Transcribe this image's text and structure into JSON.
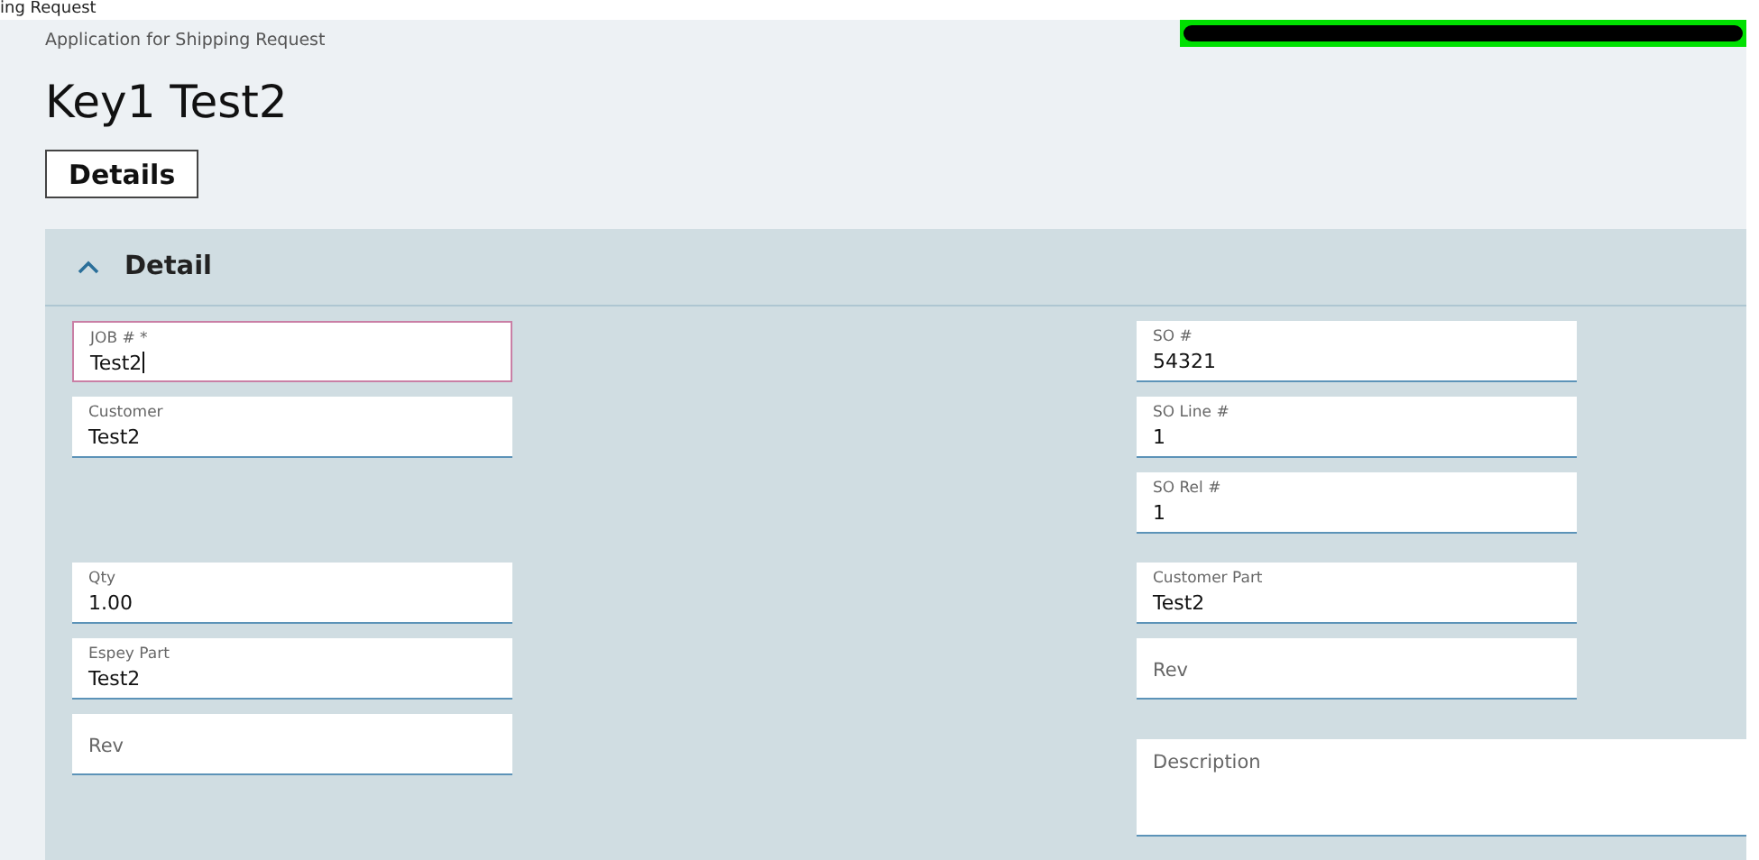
{
  "window": {
    "title": "ing Request"
  },
  "breadcrumb": "Application for Shipping Request",
  "page_title": "Key1 Test2",
  "tabs": [
    {
      "label": "Details",
      "selected": true
    }
  ],
  "section": {
    "title": "Detail",
    "expanded": true,
    "left_fields": [
      {
        "kind": "text",
        "label": "JOB # *",
        "value": "Test2",
        "focused": true
      },
      {
        "kind": "text",
        "label": "Customer",
        "value": "Test2",
        "focused": false
      },
      {
        "kind": "text",
        "label": "Qty",
        "value": "1.00",
        "focused": false
      },
      {
        "kind": "text",
        "label": "Espey Part",
        "value": "Test2",
        "focused": false
      },
      {
        "kind": "text",
        "label": "Rev",
        "focused": false
      }
    ],
    "right_fields": [
      {
        "kind": "text",
        "label": "SO #",
        "value": "54321",
        "focused": false
      },
      {
        "kind": "text",
        "label": "SO Line #",
        "value": "1",
        "focused": false
      },
      {
        "kind": "text",
        "label": "SO Rel #",
        "value": "1",
        "focused": false
      },
      {
        "kind": "text",
        "label": "Customer Part",
        "value": "Test2",
        "focused": false
      },
      {
        "kind": "text",
        "label": "Rev",
        "focused": false
      },
      {
        "kind": "multiline",
        "label": "Description",
        "focused": false
      }
    ]
  }
}
